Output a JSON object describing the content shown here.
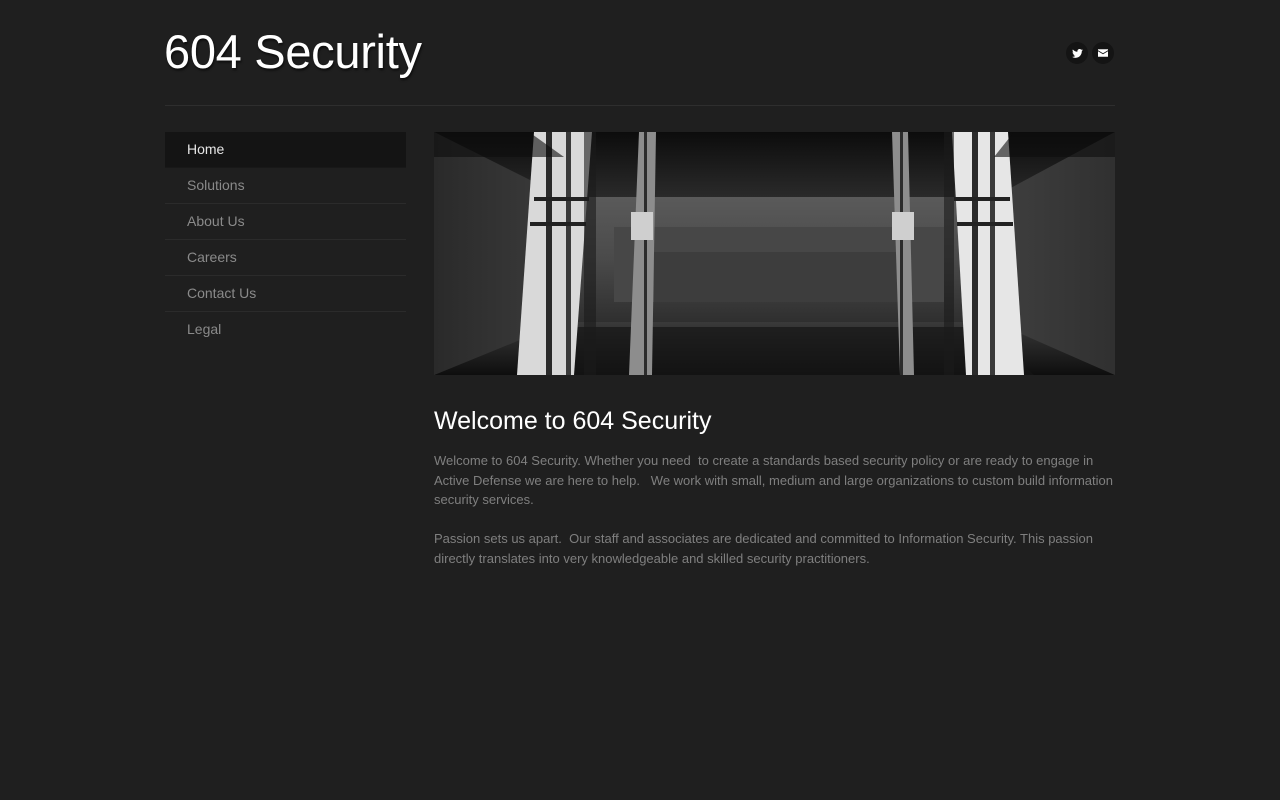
{
  "header": {
    "site_title": "604 Security",
    "social": {
      "twitter_icon": "twitter-icon",
      "email_icon": "email-icon"
    }
  },
  "nav": {
    "items": [
      {
        "label": "Home",
        "active": true
      },
      {
        "label": "Solutions",
        "active": false
      },
      {
        "label": "About Us",
        "active": false
      },
      {
        "label": "Careers",
        "active": false
      },
      {
        "label": "Contact Us",
        "active": false
      },
      {
        "label": "Legal",
        "active": false
      }
    ]
  },
  "main": {
    "heading": "Welcome to 604 Security",
    "paragraphs": [
      "Welcome to 604 Security. Whether you need  to create a standards based security policy or are ready to engage in Active Defense we are here to help.   We work with small, medium and large organizations to custom build information security services.",
      "Passion sets us apart.  Our staff and associates are dedicated and committed to Information Security. This passion directly translates into very knowledgeable and skilled security practitioners."
    ]
  },
  "colors": {
    "background": "#1f1f1f",
    "nav_active_bg": "#141414",
    "body_text": "#7f7f7f",
    "heading_text": "#ffffff"
  }
}
